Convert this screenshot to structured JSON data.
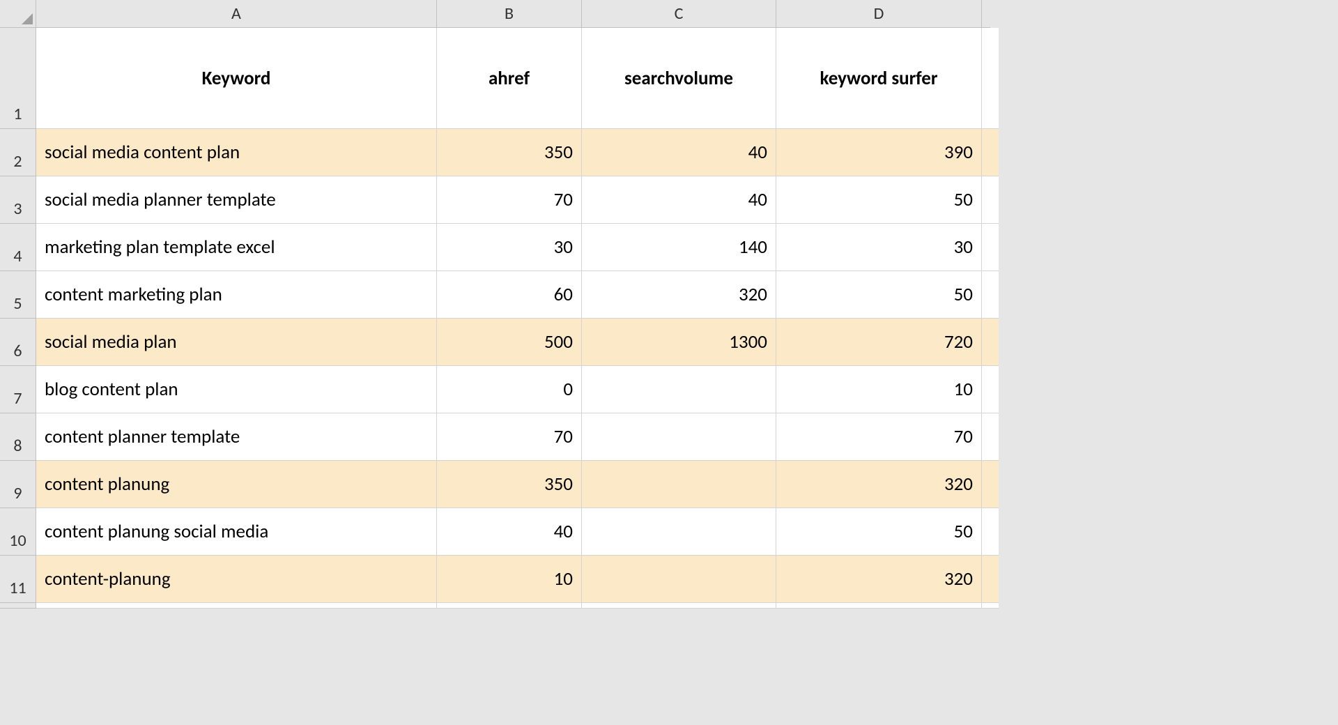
{
  "columns": [
    "A",
    "B",
    "C",
    "D"
  ],
  "rows": [
    "1",
    "2",
    "3",
    "4",
    "5",
    "6",
    "7",
    "8",
    "9",
    "10",
    "11"
  ],
  "headers": {
    "keyword": "Keyword",
    "ahref": "ahref",
    "searchvolume": "searchvolume",
    "keyword_surfer": "keyword surfer"
  },
  "data": [
    {
      "keyword": "social media content plan",
      "ahref": "350",
      "searchvolume": "40",
      "keyword_surfer": "390",
      "highlighted": true
    },
    {
      "keyword": "social media planner template",
      "ahref": "70",
      "searchvolume": "40",
      "keyword_surfer": "50",
      "highlighted": false
    },
    {
      "keyword": "marketing plan template excel",
      "ahref": "30",
      "searchvolume": "140",
      "keyword_surfer": "30",
      "highlighted": false
    },
    {
      "keyword": "content marketing plan",
      "ahref": "60",
      "searchvolume": "320",
      "keyword_surfer": "50",
      "highlighted": false
    },
    {
      "keyword": "social media plan",
      "ahref": "500",
      "searchvolume": "1300",
      "keyword_surfer": "720",
      "highlighted": true
    },
    {
      "keyword": "blog content plan",
      "ahref": "0",
      "searchvolume": "",
      "keyword_surfer": "10",
      "highlighted": false
    },
    {
      "keyword": "content planner template",
      "ahref": "70",
      "searchvolume": "",
      "keyword_surfer": "70",
      "highlighted": false
    },
    {
      "keyword": "content planung",
      "ahref": "350",
      "searchvolume": "",
      "keyword_surfer": "320",
      "highlighted": true
    },
    {
      "keyword": "content planung social media",
      "ahref": "40",
      "searchvolume": "",
      "keyword_surfer": "50",
      "highlighted": false
    },
    {
      "keyword": "content-planung",
      "ahref": "10",
      "searchvolume": "",
      "keyword_surfer": "320",
      "highlighted": true
    }
  ]
}
